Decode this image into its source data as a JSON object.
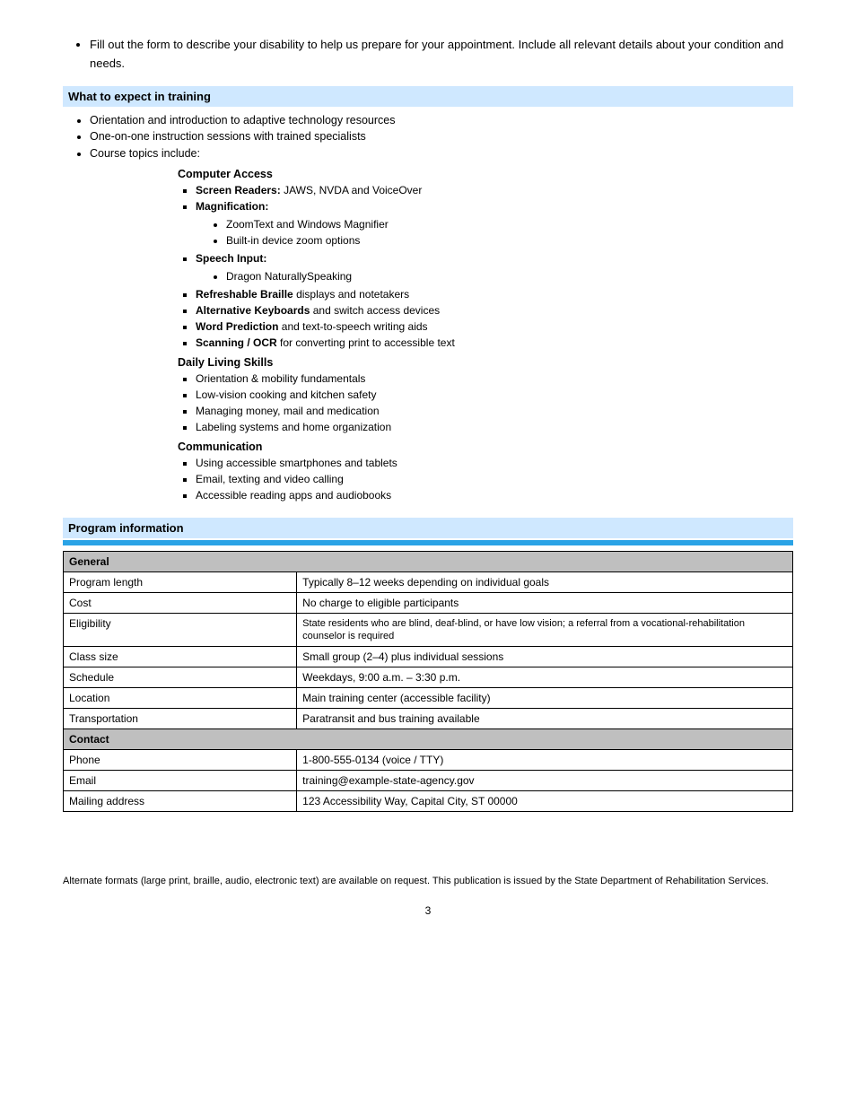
{
  "top_bullet": "Fill out the form to describe your disability to help us prepare for your appointment. Include all relevant details about your condition and needs.",
  "bar1_title": "What to expect in training",
  "triple_items": [
    "Orientation and introduction to adaptive technology resources",
    "One-on-one instruction sessions with trained specialists",
    "Course topics include:"
  ],
  "courses": {
    "sub1": "Computer Access",
    "sq1": [
      {
        "label": "Screen Readers:",
        "after": "JAWS, NVDA and VoiceOver"
      },
      {
        "label": "Magnification:",
        "after": ""
      }
    ],
    "sq1_sub": [
      "ZoomText and Windows Magnifier",
      "Built-in device zoom options"
    ],
    "sq2_label": "Speech Input:",
    "sq2_sub": [
      "Dragon NaturallySpeaking"
    ],
    "sq3": [
      {
        "label": "Refreshable Braille",
        "after": "displays and notetakers"
      },
      {
        "label": "Alternative Keyboards",
        "after": "and switch access devices"
      },
      {
        "label": "Word Prediction",
        "after": "and text-to-speech writing aids"
      },
      {
        "label": "Scanning / OCR",
        "after": "for converting print to accessible text"
      }
    ],
    "sub2": "Daily Living Skills",
    "dl": [
      "Orientation & mobility fundamentals",
      "Low-vision cooking and kitchen safety",
      "Managing money, mail and medication",
      "Labeling systems and home organization"
    ],
    "sub3": "Communication",
    "comm": [
      "Using accessible smartphones and tablets",
      "Email, texting and video calling",
      "Accessible reading apps and audiobooks"
    ]
  },
  "bar2_title": "Program information",
  "table": {
    "group1": "General",
    "rows1": [
      [
        "Program length",
        "Typically 8–12 weeks depending on individual goals"
      ],
      [
        "Cost",
        "No charge to eligible participants"
      ],
      [
        "Eligibility",
        "State residents who are blind, deaf-blind, or have low vision; a referral from a vocational-rehabilitation counselor is required"
      ],
      [
        "Class size",
        "Small group (2–4) plus individual sessions"
      ],
      [
        "Schedule",
        "Weekdays, 9:00 a.m. – 3:30 p.m."
      ],
      [
        "Location",
        "Main training center (accessible facility)"
      ],
      [
        "Transportation",
        "Paratransit and bus training available"
      ]
    ],
    "group2": "Contact",
    "rows2": [
      [
        "Phone",
        "1-800-555-0134 (voice / TTY)"
      ],
      [
        "Email",
        "training@example-state-agency.gov"
      ],
      [
        "Mailing address",
        "123 Accessibility Way, Capital City, ST 00000"
      ]
    ]
  },
  "footer": "Alternate formats (large print, braille, audio, electronic text) are available on request. This publication is issued by the State Department of Rehabilitation Services.",
  "page_number": "3"
}
